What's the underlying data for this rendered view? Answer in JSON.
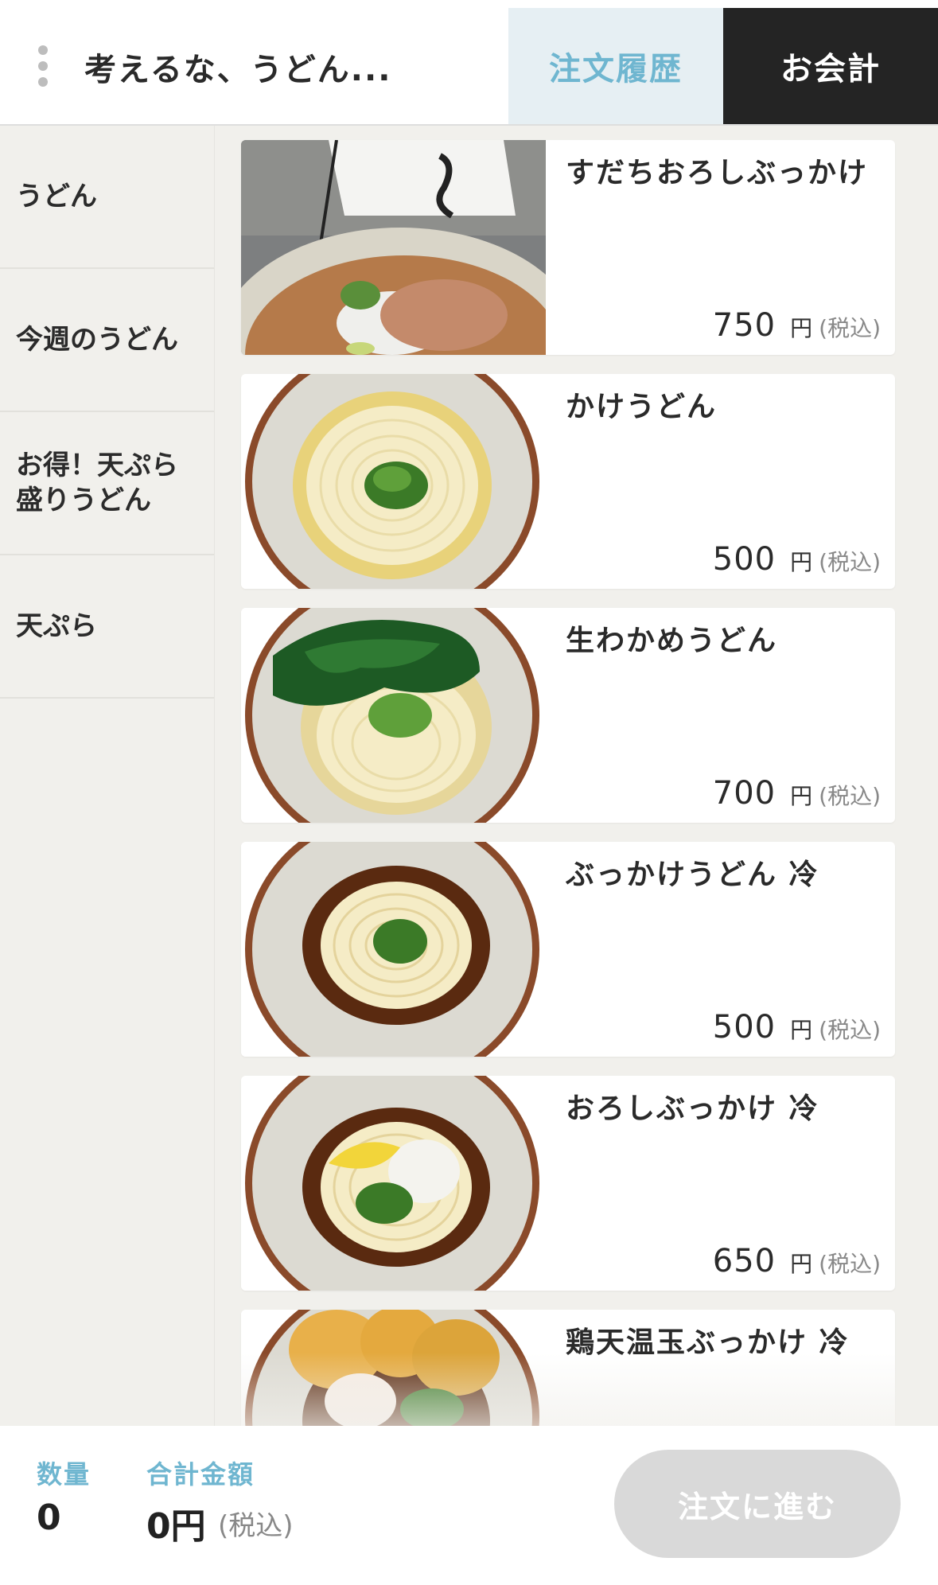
{
  "header": {
    "shop_name": "考えるな、うどん...",
    "tab_history": "注文履歴",
    "tab_checkout": "お会計"
  },
  "sidebar": {
    "categories": [
      {
        "label": "うどん"
      },
      {
        "label": "今週のうどん"
      },
      {
        "label": "お得！天ぷら\n盛りうどん"
      },
      {
        "label": "天ぷら"
      }
    ]
  },
  "menu": {
    "items": [
      {
        "name": "すだちおろしぶっかけ",
        "price": "750",
        "yen": "円",
        "tax": "(税込)"
      },
      {
        "name": "かけうどん",
        "price": "500",
        "yen": "円",
        "tax": "(税込)"
      },
      {
        "name": "生わかめうどん",
        "price": "700",
        "yen": "円",
        "tax": "(税込)"
      },
      {
        "name": "ぶっかけうどん 冷",
        "price": "500",
        "yen": "円",
        "tax": "(税込)"
      },
      {
        "name": "おろしぶっかけ 冷",
        "price": "650",
        "yen": "円",
        "tax": "(税込)"
      },
      {
        "name": "鶏天温玉ぶっかけ 冷",
        "price": "",
        "yen": "",
        "tax": ""
      }
    ]
  },
  "footer": {
    "qty_label": "数量",
    "qty_value": "0",
    "total_label": "合計金額",
    "total_value": "0円",
    "total_tax": "(税込)",
    "order_button": "注文に進む"
  },
  "colors": {
    "accent": "#6fb6d0",
    "checkout_bg": "#242424",
    "history_bg": "#e6eff3",
    "disabled_button": "#d9d9d9"
  }
}
